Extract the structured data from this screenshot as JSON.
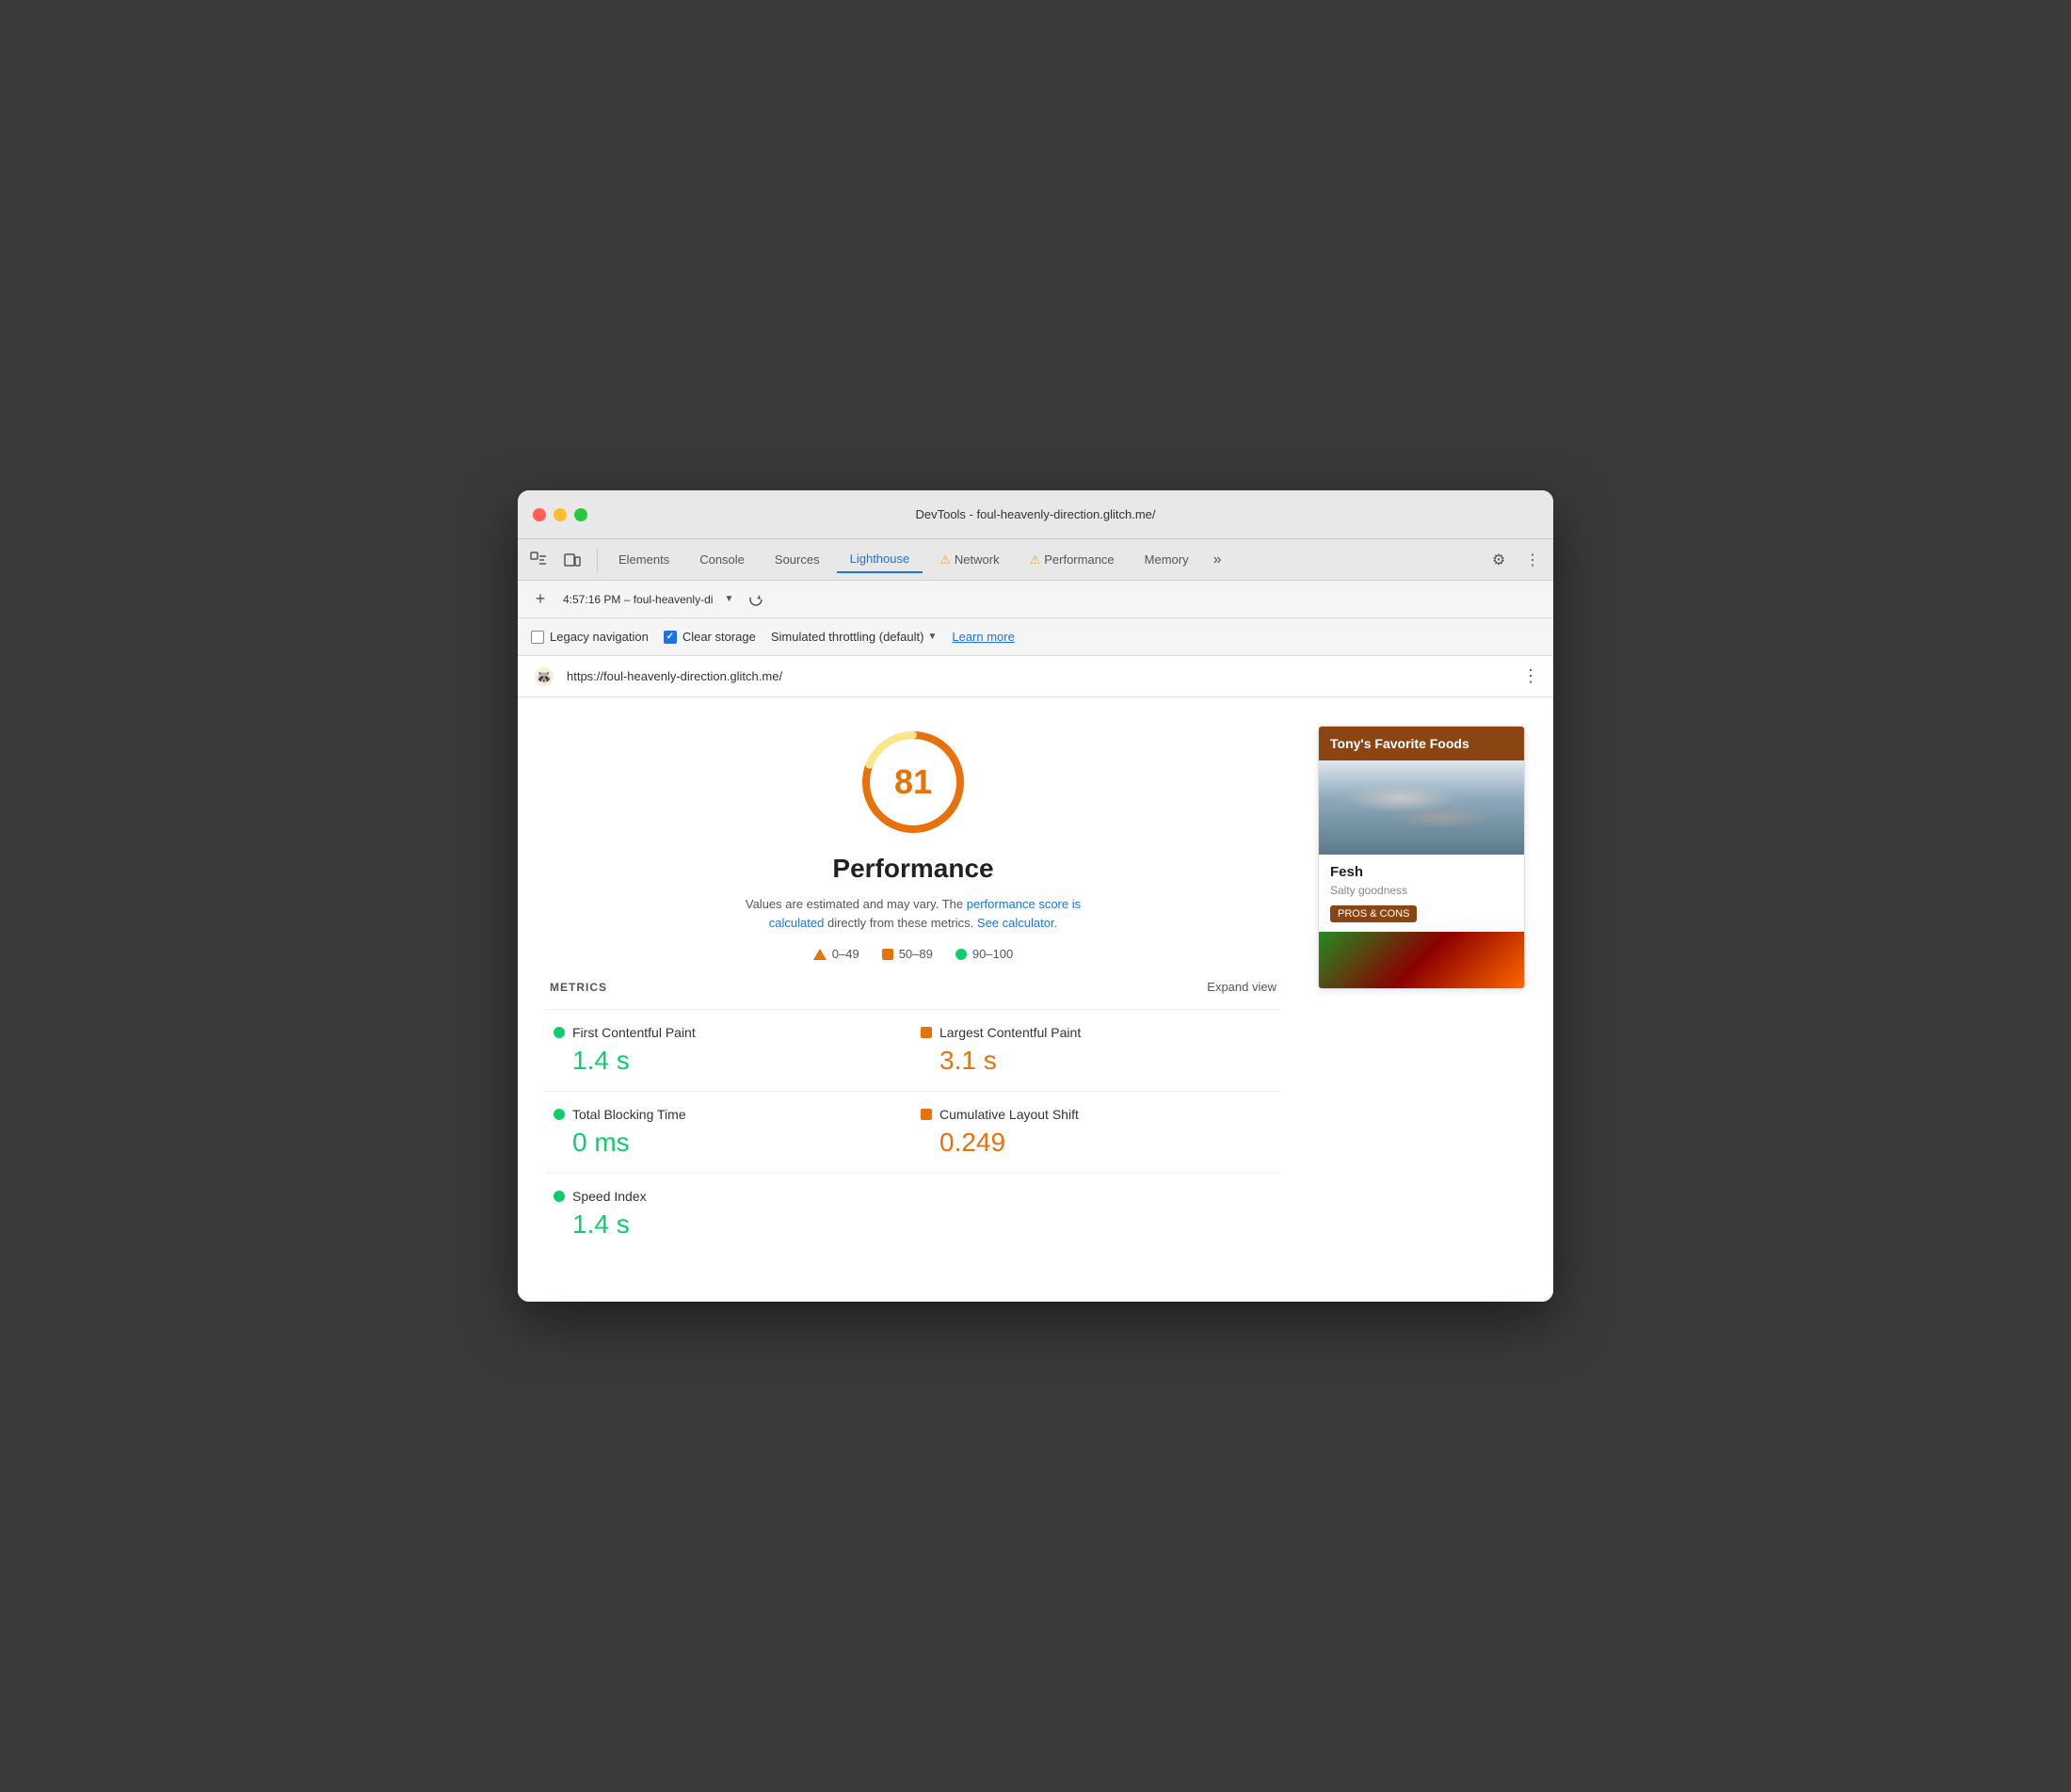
{
  "window": {
    "title": "DevTools - foul-heavenly-direction.glitch.me/"
  },
  "tabs": [
    {
      "id": "elements",
      "label": "Elements",
      "active": false,
      "warning": false
    },
    {
      "id": "console",
      "label": "Console",
      "active": false,
      "warning": false
    },
    {
      "id": "sources",
      "label": "Sources",
      "active": false,
      "warning": false
    },
    {
      "id": "lighthouse",
      "label": "Lighthouse",
      "active": true,
      "warning": false
    },
    {
      "id": "network",
      "label": "Network",
      "active": false,
      "warning": true
    },
    {
      "id": "performance",
      "label": "Performance",
      "active": false,
      "warning": true
    },
    {
      "id": "memory",
      "label": "Memory",
      "active": false,
      "warning": false
    }
  ],
  "toolbar": {
    "session_label": "4:57:16 PM – foul-heavenly-di",
    "add_label": "+"
  },
  "options": {
    "legacy_nav_label": "Legacy navigation",
    "legacy_nav_checked": false,
    "clear_storage_label": "Clear storage",
    "clear_storage_checked": true,
    "throttle_label": "Simulated throttling (default)",
    "learn_more_label": "Learn more"
  },
  "url_bar": {
    "url": "https://foul-heavenly-direction.glitch.me/"
  },
  "score_section": {
    "score": "81",
    "title": "Performance",
    "description_text": "Values are estimated and may vary. The",
    "link1_text": "performance score is calculated",
    "link1_middle": "directly from these metrics.",
    "link2_text": "See calculator.",
    "legend": [
      {
        "type": "triangle",
        "range": "0–49"
      },
      {
        "type": "square",
        "range": "50–89"
      },
      {
        "type": "circle",
        "range": "90–100"
      }
    ]
  },
  "metrics_section": {
    "title": "METRICS",
    "expand_label": "Expand view",
    "items": [
      {
        "label": "First Contentful Paint",
        "value": "1.4 s",
        "dot_type": "circle",
        "color": "green"
      },
      {
        "label": "Largest Contentful Paint",
        "value": "3.1 s",
        "dot_type": "square",
        "color": "orange"
      },
      {
        "label": "Total Blocking Time",
        "value": "0 ms",
        "dot_type": "circle",
        "color": "green"
      },
      {
        "label": "Cumulative Layout Shift",
        "value": "0.249",
        "dot_type": "square",
        "color": "orange"
      },
      {
        "label": "Speed Index",
        "value": "1.4 s",
        "dot_type": "circle",
        "color": "green"
      }
    ]
  },
  "food_card": {
    "header": "Tony's Favorite Foods",
    "item_name": "Fesh",
    "item_desc": "Salty goodness",
    "btn_label": "PROS & CONS"
  }
}
